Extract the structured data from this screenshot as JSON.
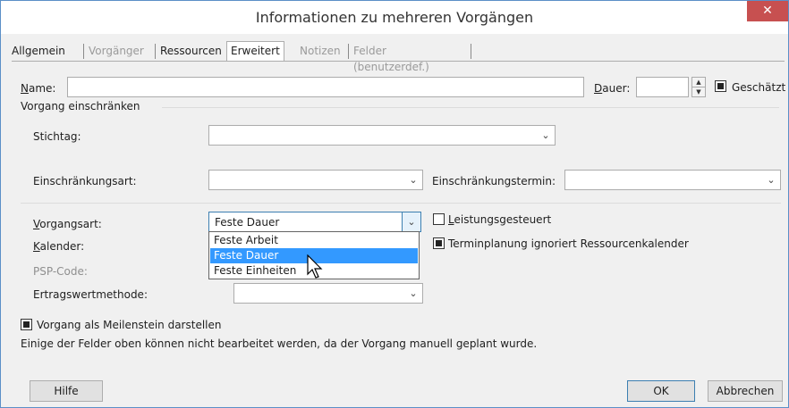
{
  "window": {
    "title": "Informationen zu mehreren Vorgängen",
    "close_glyph": "✕"
  },
  "tabs": [
    {
      "label": "Allgemein",
      "state": "normal"
    },
    {
      "label": "Vorgänger",
      "state": "dim"
    },
    {
      "label": "Ressourcen",
      "state": "normal"
    },
    {
      "label": "Erweitert",
      "state": "active"
    },
    {
      "label": "Notizen",
      "state": "dim"
    },
    {
      "label": "Felder (benutzerdef.)",
      "state": "dim"
    }
  ],
  "form": {
    "name_label": "Name:",
    "name_value": "",
    "dauer_label": "Dauer:",
    "dauer_value": "",
    "geschaetzt_label": "Geschätzt",
    "geschaetzt_checked": true,
    "group_label": "Vorgang einschränken",
    "stichtag_label": "Stichtag:",
    "stichtag_value": "",
    "einschraenkungsart_label": "Einschränkungsart:",
    "einschraenkungsart_value": "",
    "einschraenkungstermin_label": "Einschränkungstermin:",
    "einschraenkungstermin_value": "",
    "vorgangsart_label": "Vorgangsart:",
    "vorgangsart_value": "Feste Dauer",
    "vorgangsart_options": [
      "Feste Arbeit",
      "Feste Dauer",
      "Feste Einheiten"
    ],
    "vorgangsart_highlighted": "Feste Dauer",
    "leistungsgesteuert_label": "Leistungsgesteuert",
    "leistungsgesteuert_checked": false,
    "kalender_label": "Kalender:",
    "termin_label": "Terminplanung ignoriert Ressourcenkalender",
    "termin_checked": true,
    "psp_label": "PSP-Code:",
    "ertrag_label": "Ertragswertmethode:",
    "ertrag_value": "",
    "meilenstein_label": "Vorgang als Meilenstein darstellen",
    "meilenstein_checked": true,
    "note": "Einige der Felder oben können nicht bearbeitet werden, da der Vorgang manuell geplant wurde."
  },
  "buttons": {
    "hilfe": "Hilfe",
    "ok": "OK",
    "abbrechen": "Abbrechen"
  },
  "icons": {
    "dropdown_arrow": "chevron-down-icon",
    "spin_up": "▲",
    "spin_down": "▼",
    "arrow_glyph": "⌄"
  }
}
